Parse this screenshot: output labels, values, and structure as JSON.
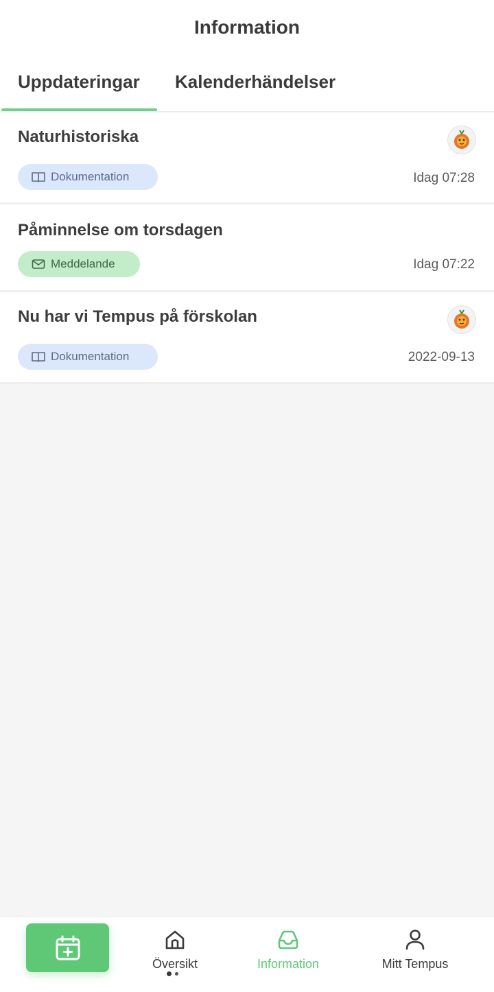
{
  "header": {
    "title": "Information"
  },
  "tabs": [
    {
      "label": "Uppdateringar",
      "active": true
    },
    {
      "label": "Kalenderhändelser",
      "active": false
    }
  ],
  "items": [
    {
      "title": "Naturhistoriska",
      "badge": "Dokumentation",
      "badge_type": "doc",
      "badge_icon": "book-icon",
      "date": "Idag 07:28",
      "has_avatar": true
    },
    {
      "title": "Påminnelse om torsdagen",
      "badge": "Meddelande",
      "badge_type": "msg",
      "badge_icon": "mail-icon",
      "date": "Idag 07:22",
      "has_avatar": false
    },
    {
      "title": "Nu har vi Tempus på förskolan",
      "badge": "Dokumentation",
      "badge_type": "doc",
      "badge_icon": "book-icon",
      "date": "2022-09-13",
      "has_avatar": true
    }
  ],
  "bottom_nav": {
    "fab_icon": "calendar-add-icon",
    "items": [
      {
        "label": "Översikt",
        "icon": "home-icon",
        "active": false
      },
      {
        "label": "Information",
        "icon": "inbox-icon",
        "active": true
      },
      {
        "label": "Mitt Tempus",
        "icon": "user-icon",
        "active": false
      }
    ],
    "page_indicator": {
      "pages": 2,
      "current": 1
    }
  },
  "colors": {
    "accent": "#5fc877",
    "doc_badge": "#dbe7fb",
    "msg_badge": "#c3ecc9",
    "background": "#f5f5f5"
  }
}
